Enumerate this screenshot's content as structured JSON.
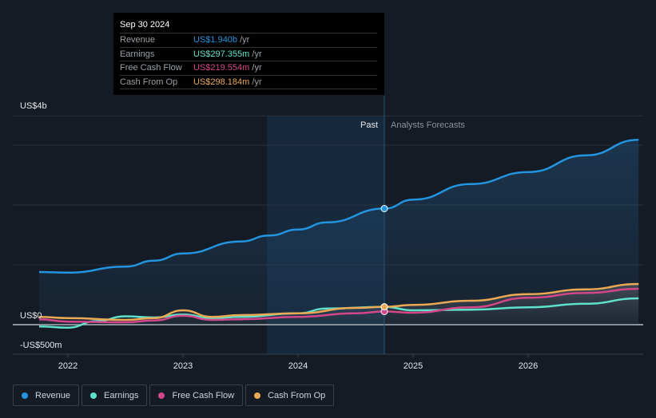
{
  "tooltip": {
    "date": "Sep 30 2024",
    "rows": [
      {
        "label": "Revenue",
        "value": "US$1.940b",
        "unit": "/yr",
        "color": "#2394df"
      },
      {
        "label": "Earnings",
        "value": "US$297.355m",
        "unit": "/yr",
        "color": "#5ee2cc"
      },
      {
        "label": "Free Cash Flow",
        "value": "US$219.554m",
        "unit": "/yr",
        "color": "#d4468a"
      },
      {
        "label": "Cash From Op",
        "value": "US$298.184m",
        "unit": "/yr",
        "color": "#eaa952"
      }
    ]
  },
  "chart_data": {
    "type": "line",
    "title": "",
    "xlabel": "",
    "ylabel": "",
    "y_tick_labels": [
      "US$4b",
      "US$0",
      "-US$500m"
    ],
    "x_tick_labels": [
      "2022",
      "2023",
      "2024",
      "2025",
      "2026"
    ],
    "x_ticks": [
      2022,
      2023,
      2024,
      2025,
      2026
    ],
    "xlim": [
      2021.55,
      2027.0
    ],
    "ylim": [
      -0.5,
      3.49
    ],
    "y_unit": "US$ billions",
    "past_label": "Past",
    "forecast_label": "Analysts Forecasts",
    "past_region": [
      2023.73,
      2024.75
    ],
    "marker_x": 2024.75,
    "series": [
      {
        "name": "Revenue",
        "color": "#2394df",
        "x": [
          2021.75,
          2022,
          2022.5,
          2022.75,
          2023,
          2023.5,
          2023.75,
          2024,
          2024.25,
          2024.75,
          2025,
          2025.5,
          2026,
          2026.5,
          2026.96
        ],
        "values": [
          0.88,
          0.87,
          0.97,
          1.07,
          1.19,
          1.39,
          1.49,
          1.59,
          1.71,
          1.94,
          2.09,
          2.35,
          2.55,
          2.83,
          3.09
        ]
      },
      {
        "name": "Earnings",
        "color": "#5ee2cc",
        "x": [
          2021.75,
          2022,
          2022.25,
          2022.5,
          2022.75,
          2023,
          2023.25,
          2023.5,
          2024,
          2024.25,
          2024.75,
          2025,
          2025.5,
          2026,
          2026.5,
          2026.96
        ],
        "values": [
          -0.03,
          -0.05,
          0.06,
          0.14,
          0.12,
          0.17,
          0.11,
          0.13,
          0.19,
          0.27,
          0.297,
          0.24,
          0.25,
          0.29,
          0.35,
          0.44
        ]
      },
      {
        "name": "Free Cash Flow",
        "color": "#d4468a",
        "x": [
          2021.75,
          2022,
          2022.5,
          2022.75,
          2023,
          2023.25,
          2023.5,
          2024,
          2024.5,
          2024.75,
          2025,
          2025.5,
          2026,
          2026.5,
          2026.96
        ],
        "values": [
          0.09,
          0.05,
          0.04,
          0.07,
          0.15,
          0.08,
          0.09,
          0.13,
          0.19,
          0.22,
          0.2,
          0.29,
          0.45,
          0.53,
          0.6
        ]
      },
      {
        "name": "Cash From Op",
        "color": "#eaa952",
        "x": [
          2021.75,
          2022,
          2022.5,
          2022.75,
          2023,
          2023.25,
          2023.5,
          2024,
          2024.5,
          2024.75,
          2025,
          2025.5,
          2026,
          2026.5,
          2026.96
        ],
        "values": [
          0.13,
          0.11,
          0.08,
          0.11,
          0.24,
          0.13,
          0.16,
          0.19,
          0.28,
          0.298,
          0.33,
          0.4,
          0.51,
          0.59,
          0.68
        ]
      }
    ]
  }
}
